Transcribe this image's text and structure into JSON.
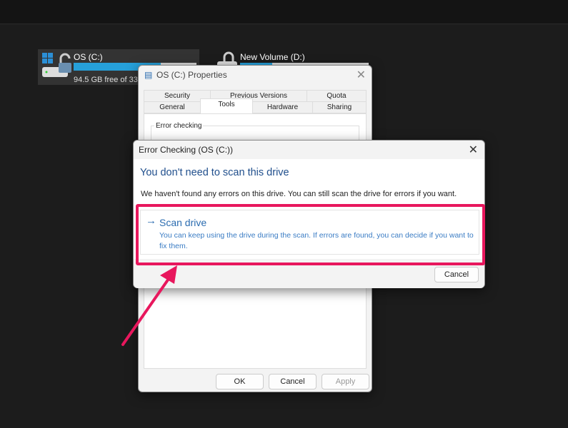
{
  "drives": [
    {
      "name": "OS (C:)",
      "free_text": "94.5 GB free of 33",
      "used_fraction": 0.71,
      "selected": true
    },
    {
      "name": "New Volume (D:)",
      "used_fraction": 0.25,
      "selected": false
    }
  ],
  "properties": {
    "title": "OS (C:) Properties",
    "tabs_top": [
      "Security",
      "Previous Versions",
      "Quota"
    ],
    "tabs_bottom": [
      "General",
      "Tools",
      "Hardware",
      "Sharing"
    ],
    "active_tab": "Tools",
    "section": "Error checking",
    "ok": "OK",
    "cancel": "Cancel",
    "apply": "Apply"
  },
  "error_dialog": {
    "title": "Error Checking (OS (C:))",
    "heading": "You don't need to scan this drive",
    "message": "We haven't found any errors on this drive. You can still scan the drive for errors if you want.",
    "scan_label": "Scan drive",
    "scan_desc": "You can keep using the drive during the scan. If errors are found, you can decide if you want to fix them.",
    "cancel": "Cancel"
  },
  "colors": {
    "accent": "#26a0da",
    "heading": "#1f4e8c",
    "link": "#2b6cb0",
    "highlight": "#e8175d"
  }
}
